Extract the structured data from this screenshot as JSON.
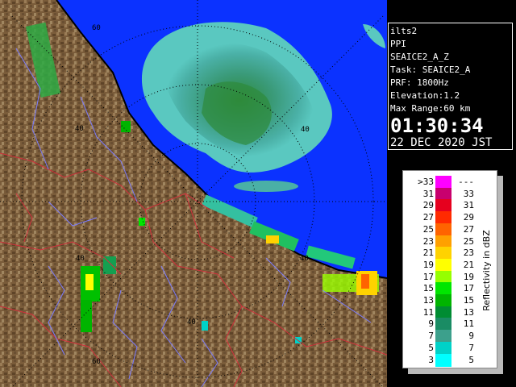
{
  "map": {
    "range_labels": [
      "60",
      "40",
      "40",
      "40",
      "40",
      "40",
      "60"
    ],
    "colors": {
      "sea": "#0b32ff",
      "land": "#7a5c3a",
      "coast": "#000000",
      "rings": "#000000",
      "prefecture_border": "#d2303c",
      "city_border": "#7a7cff"
    }
  },
  "info": {
    "station": "ilts2",
    "product": "PPI",
    "task_name": "SEAICE2_A_Z",
    "task": "Task: SEAICE2_A",
    "prf": "PRF: 1800Hz",
    "elevation": "Elevation:1.2",
    "max_range": "Max Range:60 km",
    "time": "01:30:34",
    "date": "22 DEC 2020 JST"
  },
  "legend": {
    "title": "Reflectivity in dBZ",
    "rows": [
      {
        "lo": ">33",
        "hi": "---",
        "color": "#ff00ff"
      },
      {
        "lo": "31",
        "hi": "33",
        "color": "#c8006e"
      },
      {
        "lo": "29",
        "hi": "31",
        "color": "#e6001e"
      },
      {
        "lo": "27",
        "hi": "29",
        "color": "#ff2a00"
      },
      {
        "lo": "25",
        "hi": "27",
        "color": "#ff6400"
      },
      {
        "lo": "23",
        "hi": "25",
        "color": "#ffa000"
      },
      {
        "lo": "21",
        "hi": "23",
        "color": "#ffd200"
      },
      {
        "lo": "19",
        "hi": "21",
        "color": "#ffff00"
      },
      {
        "lo": "17",
        "hi": "19",
        "color": "#96ff00"
      },
      {
        "lo": "15",
        "hi": "17",
        "color": "#00e600"
      },
      {
        "lo": "13",
        "hi": "15",
        "color": "#00b400"
      },
      {
        "lo": "11",
        "hi": "13",
        "color": "#008c32"
      },
      {
        "lo": "9",
        "hi": "11",
        "color": "#1a8c64"
      },
      {
        "lo": "7",
        "hi": "9",
        "color": "#3ca08c"
      },
      {
        "lo": "5",
        "hi": "7",
        "color": "#00d2c8"
      },
      {
        "lo": "3",
        "hi": "5",
        "color": "#00ffff"
      }
    ]
  }
}
